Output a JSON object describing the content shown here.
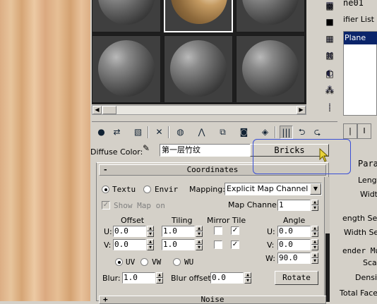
{
  "material_slots": {
    "count": 6,
    "selected_index": 1
  },
  "diffuse": {
    "label": "Diffuse Color:",
    "name": "第一层竹纹",
    "type_button": "Bricks"
  },
  "coordinates": {
    "title": "Coordinates",
    "collapse_symbol": "-",
    "texture_label": "Textu",
    "environ_label": "Envir",
    "mapping_label": "Mapping:",
    "mapping_value": "Explicit Map Channel",
    "show_map_label": "Show Map on",
    "map_channel_label": "Map Channel:",
    "map_channel_value": "1",
    "offset_header": "Offset",
    "tiling_header": "Tiling",
    "mirror_tile_header": "Mirror Tile",
    "angle_header": "Angle",
    "u_label": "U:",
    "v_label": "V:",
    "w_label": "W:",
    "offset_u": "0.0",
    "offset_v": "0.0",
    "tiling_u": "1.0",
    "tiling_v": "1.0",
    "angle_u": "0.0",
    "angle_v": "0.0",
    "angle_w": "90.0",
    "uv_label": "UV",
    "vw_label": "VW",
    "wu_label": "WU",
    "blur_label": "Blur:",
    "blur_value": "1.0",
    "blur_offset_label": "Blur offset:",
    "blur_offset_value": "0.0",
    "rotate_label": "Rotate"
  },
  "noise": {
    "title": "Noise",
    "expand_symbol": "+"
  },
  "right_panel": {
    "object_name": "ne01",
    "modifier_list": "ifier List",
    "stack_item": "Plane",
    "params_header": "Para",
    "length_label": "Lengt",
    "width_label": "Widt",
    "length_segs": "ength Seg",
    "width_segs": "Width Seg",
    "render_mult": "ender Mu",
    "scale_label": "Scal",
    "density_label": "Densit",
    "total_faces": "Total Face"
  },
  "colors": {
    "panel_bg": "#d4d0c8",
    "highlight_border": "#3a4fd6",
    "selection_bg": "#0a246a"
  }
}
